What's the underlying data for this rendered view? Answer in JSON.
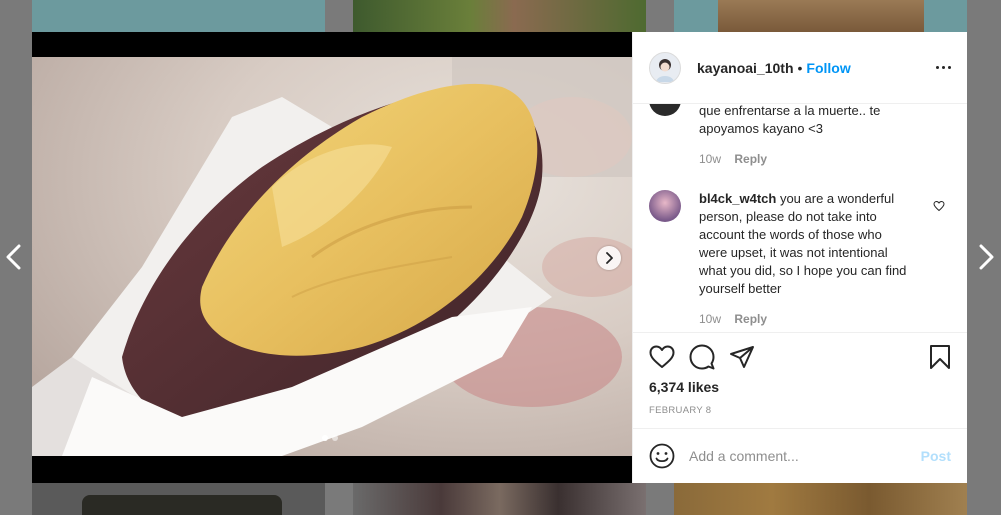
{
  "header": {
    "username": "kayanoai_10th",
    "separator": "•",
    "follow_label": "Follow",
    "more_icon": "more-horizontal-icon"
  },
  "comments": [
    {
      "username": "",
      "text": "que enfrentarse a la muerte.. te apoyamos kayano <3",
      "age": "10w",
      "reply_label": "Reply"
    },
    {
      "username": "bl4ck_w4tch",
      "text": "you are a wonderful person, please do not take into account the words of those who were upset, it was not intentional what you did, so I hope you can find yourself better",
      "age": "10w",
      "reply_label": "Reply"
    }
  ],
  "actions": {
    "likes": "6,374 likes",
    "date": "FEBRUARY 8"
  },
  "add_comment": {
    "placeholder": "Add a comment...",
    "post_label": "Post"
  },
  "carousel": {
    "total": 2,
    "active": 1
  },
  "colors": {
    "accent": "#0095f6",
    "post_disabled": "#b2dffc",
    "muted": "#8e8e8e"
  }
}
